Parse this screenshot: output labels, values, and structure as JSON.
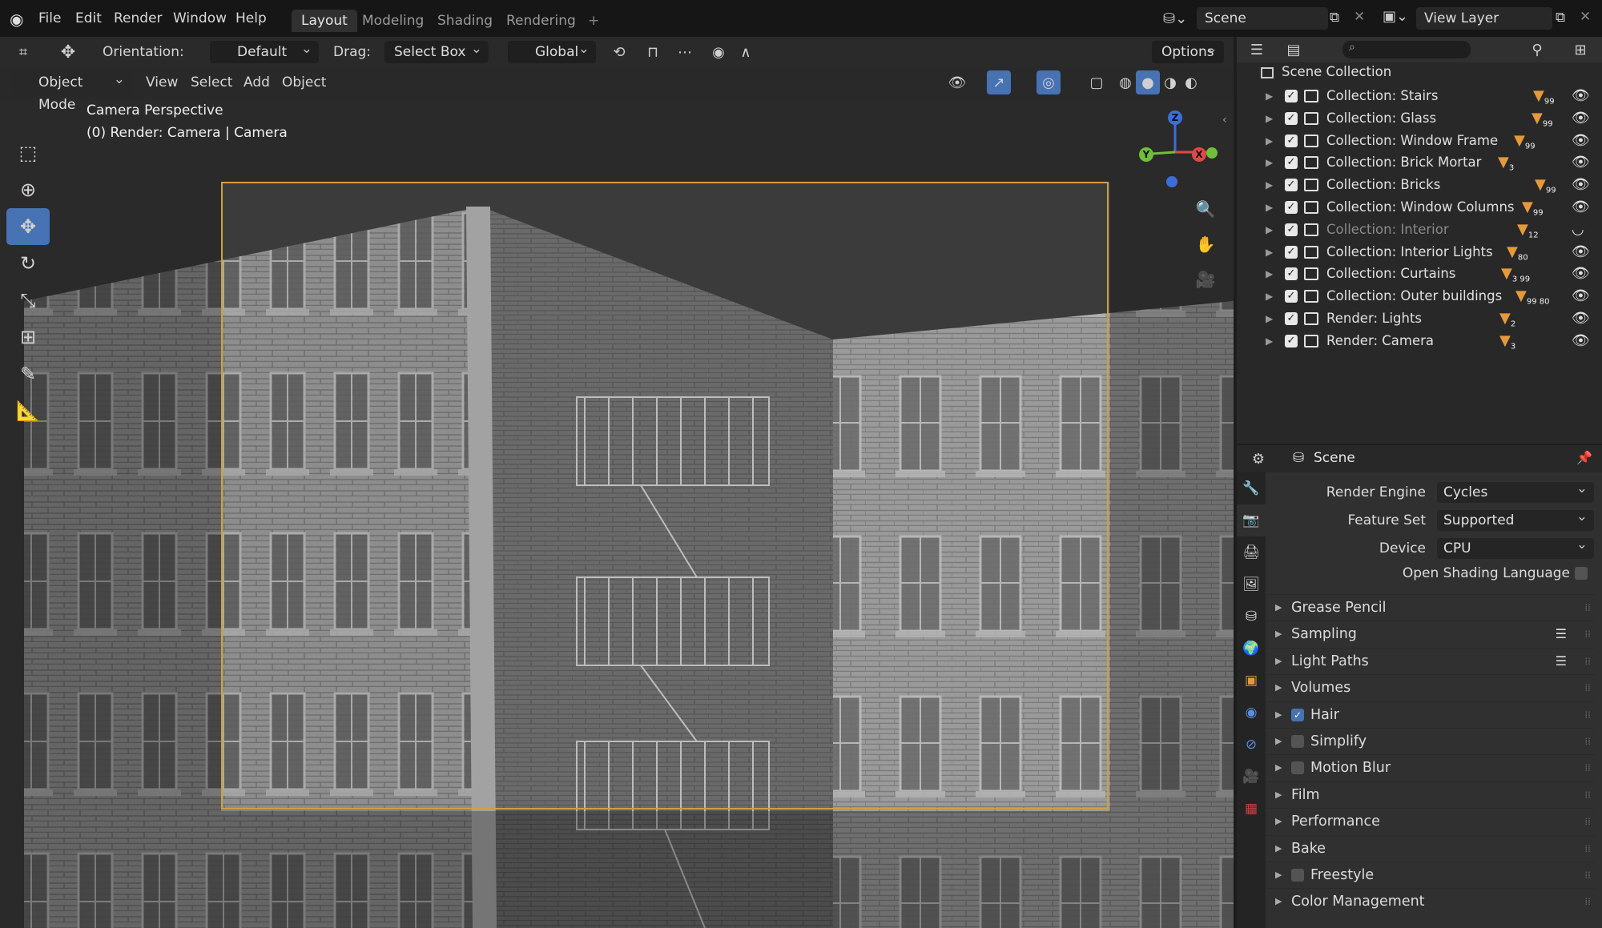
{
  "menu": [
    "File",
    "Edit",
    "Render",
    "Window",
    "Help"
  ],
  "workspaces": [
    "Layout",
    "Modeling",
    "Shading",
    "Rendering"
  ],
  "active_workspace": "Layout",
  "scene_field": "Scene",
  "view_layer_field": "View Layer",
  "header": {
    "orientation_label": "Orientation:",
    "orientation_value": "Default",
    "drag_label": "Drag:",
    "drag_value": "Select Box",
    "transform_value": "Global",
    "options_label": "Options",
    "mode_value": "Object Mode",
    "view_menu": [
      "View",
      "Select",
      "Add",
      "Object"
    ]
  },
  "viewport": {
    "info_line1": "Camera Perspective",
    "info_line2": "(0) Render: Camera | Camera",
    "gizmo_labels": {
      "z": "Z",
      "y": "Y",
      "x": "X"
    }
  },
  "outliner": {
    "root": "Scene Collection",
    "rows": [
      {
        "label": "Collection: Stairs",
        "badge": "99",
        "dim": false
      },
      {
        "label": "Collection: Glass",
        "badge": "99",
        "dim": false
      },
      {
        "label": "Collection: Window Frame",
        "badge": "99",
        "dim": false
      },
      {
        "label": "Collection: Brick Mortar",
        "badge": "3",
        "dim": false
      },
      {
        "label": "Collection: Bricks",
        "badge": "99",
        "dim": false
      },
      {
        "label": "Collection: Window Columns",
        "badge": "99",
        "dim": false
      },
      {
        "label": "Collection: Interior",
        "badge": "12",
        "dim": true
      },
      {
        "label": "Collection: Interior Lights",
        "badge": "80",
        "dim": false
      },
      {
        "label": "Collection: Curtains",
        "badge": "3 99",
        "dim": false
      },
      {
        "label": "Collection: Outer buildings",
        "badge": "99 80",
        "dim": false
      },
      {
        "label": "Render: Lights",
        "badge": "2",
        "dim": false
      },
      {
        "label": "Render: Camera",
        "badge": "3",
        "dim": false
      }
    ]
  },
  "properties": {
    "title": "Scene",
    "render_engine_label": "Render Engine",
    "render_engine_value": "Cycles",
    "feature_set_label": "Feature Set",
    "feature_set_value": "Supported",
    "device_label": "Device",
    "device_value": "CPU",
    "osl_label": "Open Shading Language",
    "panels": [
      {
        "label": "Grease Pencil",
        "checkbox": null,
        "list": false
      },
      {
        "label": "Sampling",
        "checkbox": null,
        "list": true
      },
      {
        "label": "Light Paths",
        "checkbox": null,
        "list": true
      },
      {
        "label": "Volumes",
        "checkbox": null,
        "list": false
      },
      {
        "label": "Hair",
        "checkbox": true,
        "list": false
      },
      {
        "label": "Simplify",
        "checkbox": false,
        "list": false
      },
      {
        "label": "Motion Blur",
        "checkbox": false,
        "list": false
      },
      {
        "label": "Film",
        "checkbox": null,
        "list": false
      },
      {
        "label": "Performance",
        "checkbox": null,
        "list": false
      },
      {
        "label": "Bake",
        "checkbox": null,
        "list": false
      },
      {
        "label": "Freestyle",
        "checkbox": false,
        "list": false
      },
      {
        "label": "Color Management",
        "checkbox": null,
        "list": false
      }
    ]
  },
  "colors": {
    "accent": "#4772b3",
    "camera_frame": "#c9a24a",
    "badge": "#e49a3a"
  }
}
